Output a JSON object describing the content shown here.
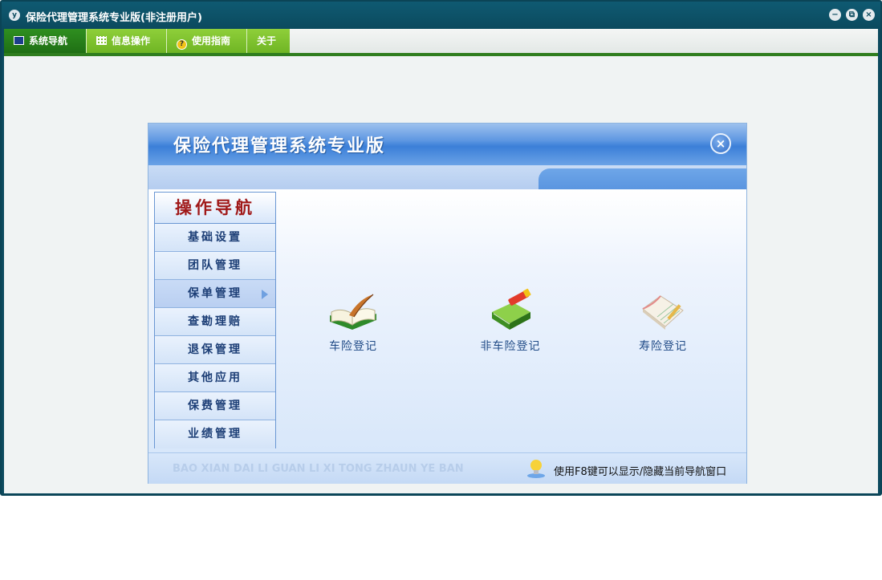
{
  "window": {
    "title": "保险代理管理系统专业版(非注册用户)",
    "controls": {
      "minimize": "−",
      "restore": "⧉",
      "close": "×"
    }
  },
  "menu": {
    "tabs": [
      {
        "label": "系统导航",
        "icon": "monitor-icon"
      },
      {
        "label": "信息操作",
        "icon": "grid-icon"
      },
      {
        "label": "使用指南",
        "icon": "help-icon"
      },
      {
        "label": "关于"
      }
    ]
  },
  "nav_panel": {
    "title": "保险代理管理系统专业版",
    "close_glyph": "×",
    "sidebar": {
      "heading": "操作导航",
      "items": [
        "基础设置",
        "团队管理",
        "保单管理",
        "查勘理赔",
        "退保管理",
        "其他应用",
        "保费管理",
        "业绩管理"
      ],
      "active_index": 2
    },
    "features": [
      {
        "label": "车险登记",
        "icon": "open-book-quill-icon"
      },
      {
        "label": "非车险登记",
        "icon": "green-book-pencil-icon"
      },
      {
        "label": "寿险登记",
        "icon": "notebook-pencil-icon"
      }
    ],
    "footer": {
      "pinyin": "BAO XIAN DAI LI GUAN LI XI TONG ZHAUN YE BAN",
      "tip": "使用F8键可以显示/隐藏当前导航窗口"
    }
  },
  "colors": {
    "title_bar": "#0b4a5e",
    "menu_active": "#2f8f20",
    "menu_inactive": "#7fc22e",
    "panel_blue": "#3b7fd8",
    "sidebar_heading": "#a01818"
  }
}
